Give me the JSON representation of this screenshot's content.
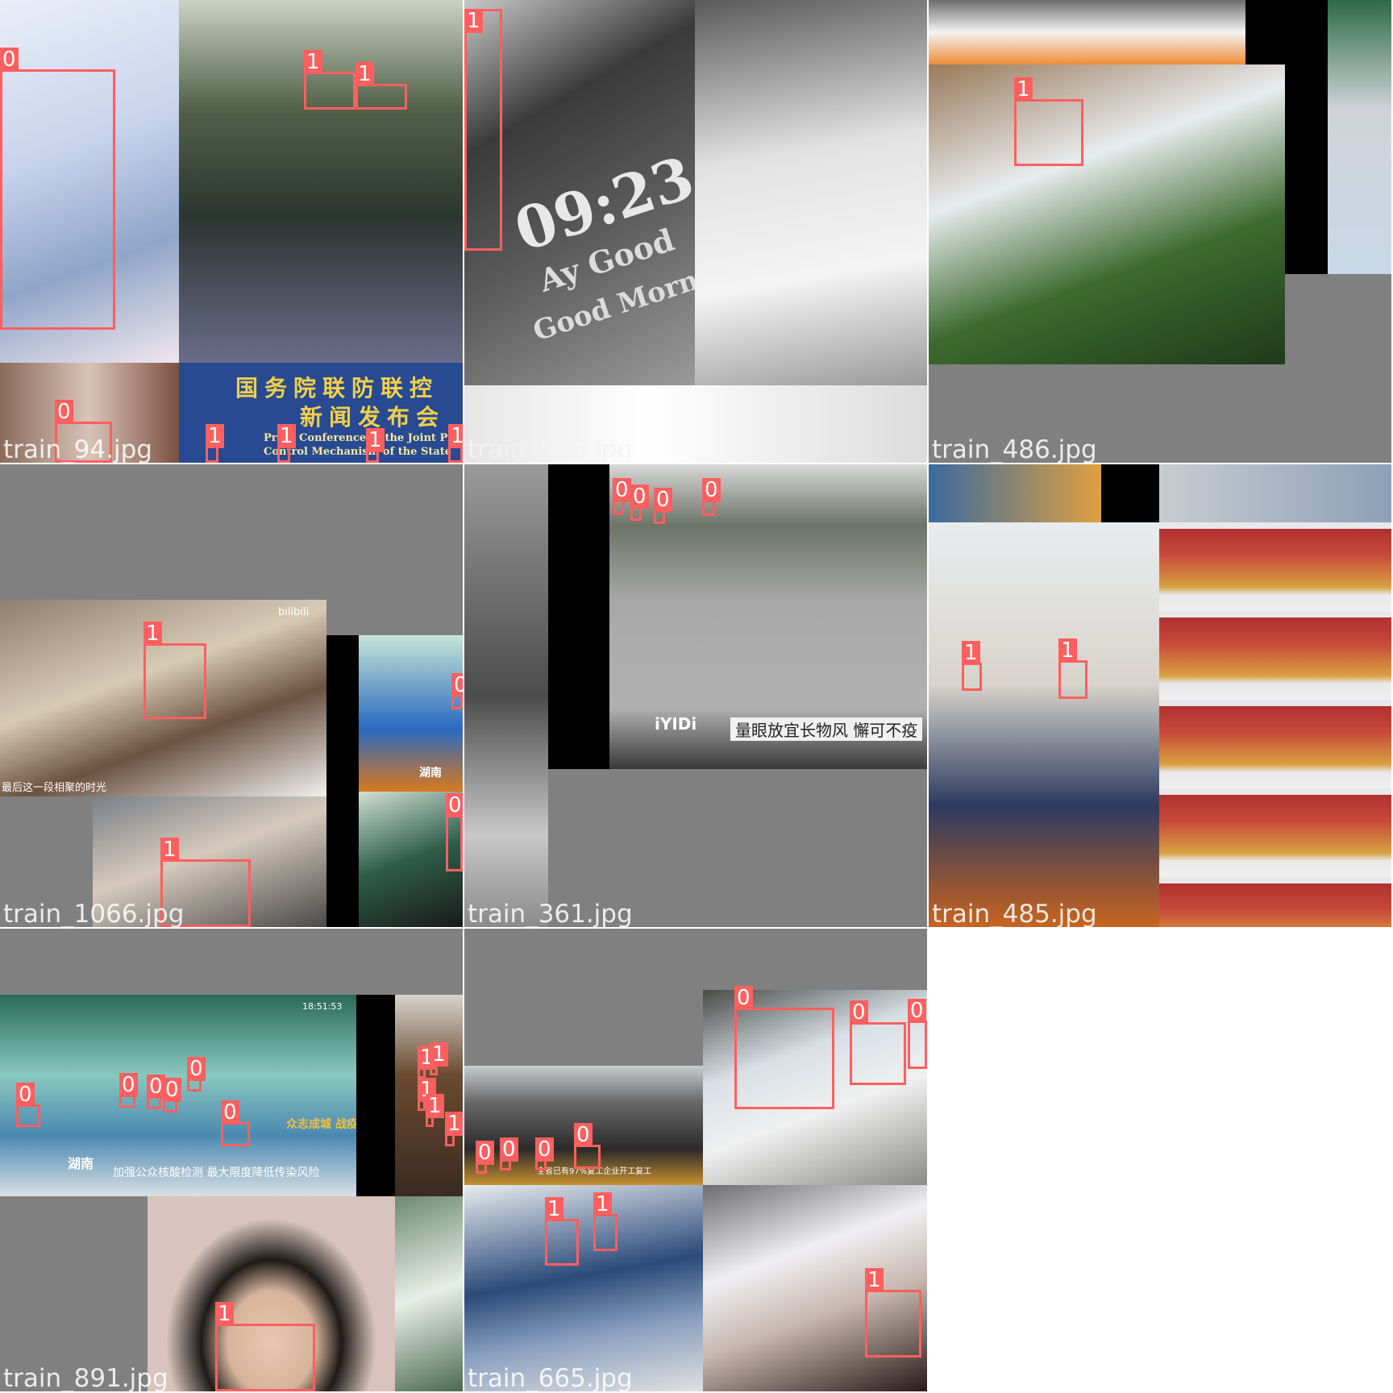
{
  "colors": {
    "box": "#ff5f5f",
    "label_text": "#ffffff",
    "caption_text": "#ffffff",
    "letterbox": "#808080"
  },
  "tiles": [
    {
      "filename": "train_94.jpg",
      "scene_texts": [
        "国务院联防联控",
        "新闻发布会",
        "Press Conference of the Joint Prevention",
        "Control Mechanism of the State"
      ],
      "boxes": [
        {
          "cls": "0"
        },
        {
          "cls": "1"
        },
        {
          "cls": "1"
        },
        {
          "cls": "0"
        },
        {
          "cls": "1"
        },
        {
          "cls": "1"
        },
        {
          "cls": "1"
        },
        {
          "cls": "1"
        }
      ]
    },
    {
      "filename": "train_566.jpg",
      "scene_texts": [
        "09:23",
        "Ay Good",
        "Good Morning"
      ],
      "boxes": [
        {
          "cls": "1"
        }
      ]
    },
    {
      "filename": "train_486.jpg",
      "scene_texts": [],
      "boxes": [
        {
          "cls": "1"
        }
      ]
    },
    {
      "filename": "train_1066.jpg",
      "scene_texts": [
        "最后这一段相聚的时光",
        "bilibili",
        "湖南"
      ],
      "boxes": [
        {
          "cls": "1"
        },
        {
          "cls": "1"
        },
        {
          "cls": "0"
        },
        {
          "cls": "0"
        }
      ]
    },
    {
      "filename": "train_361.jpg",
      "scene_texts": [
        "iYIDi",
        "量眼放宜长物风 懈可不疫"
      ],
      "boxes": [
        {
          "cls": "0"
        },
        {
          "cls": "0"
        },
        {
          "cls": "0"
        },
        {
          "cls": "0"
        }
      ]
    },
    {
      "filename": "train_485.jpg",
      "scene_texts": [],
      "boxes": [
        {
          "cls": "1"
        },
        {
          "cls": "1"
        }
      ]
    },
    {
      "filename": "train_891.jpg",
      "scene_texts": [
        "湖南",
        "加强公众核酸检测 最大限度降低传染风险",
        "众志成城 战疫情",
        "18:51:53"
      ],
      "boxes": [
        {
          "cls": "0"
        },
        {
          "cls": "0"
        },
        {
          "cls": "0"
        },
        {
          "cls": "0"
        },
        {
          "cls": "0"
        },
        {
          "cls": "0"
        },
        {
          "cls": "1"
        },
        {
          "cls": "1"
        },
        {
          "cls": "1"
        },
        {
          "cls": "1"
        },
        {
          "cls": "1"
        },
        {
          "cls": "1"
        }
      ]
    },
    {
      "filename": "train_665.jpg",
      "scene_texts": [
        "全省已有97%复工企业开工复工"
      ],
      "boxes": [
        {
          "cls": "0"
        },
        {
          "cls": "0"
        },
        {
          "cls": "0"
        },
        {
          "cls": "0"
        },
        {
          "cls": "0"
        },
        {
          "cls": "0"
        },
        {
          "cls": "0"
        },
        {
          "cls": "1"
        },
        {
          "cls": "1"
        },
        {
          "cls": "1"
        }
      ]
    }
  ]
}
